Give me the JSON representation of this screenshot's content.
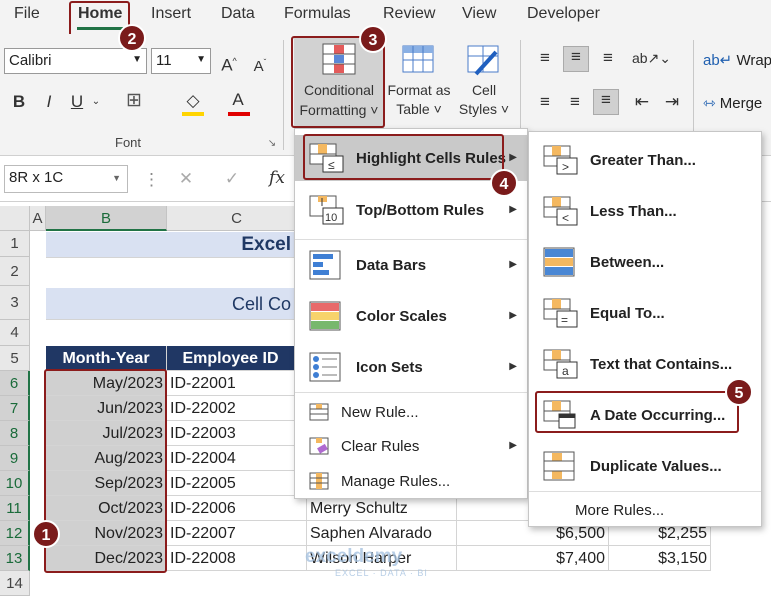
{
  "tabs": [
    "File",
    "Home",
    "Insert",
    "Data",
    "Formulas",
    "Review",
    "View",
    "Developer"
  ],
  "ribbon": {
    "font_name": "Calibri",
    "font_size": "11",
    "font_group_label": "Font",
    "conditional_formatting": [
      "Conditional",
      "Formatting ˅"
    ],
    "format_as_table": [
      "Format as",
      "Table ˅"
    ],
    "cell_styles": [
      "Cell",
      "Styles ˅"
    ],
    "wrap_text": "Wrap T",
    "merge": "Merge"
  },
  "formula_bar": {
    "name_box": "8R x 1C",
    "fx": "fx"
  },
  "columns": [
    "A",
    "B",
    "C"
  ],
  "rows": [
    "1",
    "2",
    "3",
    "4",
    "5",
    "6",
    "7",
    "8",
    "9",
    "10",
    "11",
    "12",
    "13",
    "14"
  ],
  "sheet": {
    "title_partial": "Excel",
    "subtitle_partial": "Cell Co",
    "header_b": "Month-Year",
    "header_c": "Employee ID",
    "data": [
      {
        "month": "May/2023",
        "id": "ID-22001"
      },
      {
        "month": "Jun/2023",
        "id": "ID-22002"
      },
      {
        "month": "Jul/2023",
        "id": "ID-22003"
      },
      {
        "month": "Aug/2023",
        "id": "ID-22004"
      },
      {
        "month": "Sep/2023",
        "id": "ID-22005"
      },
      {
        "month": "Oct/2023",
        "id": "ID-22006",
        "name": "Merry Schultz"
      },
      {
        "month": "Nov/2023",
        "id": "ID-22007",
        "name": "Saphen Alvarado",
        "v1": "$6,500",
        "v2": "$2,255"
      },
      {
        "month": "Dec/2023",
        "id": "ID-22008",
        "name": "Wilson Harper",
        "v1": "$7,400",
        "v2": "$3,150"
      }
    ]
  },
  "cf_menu": {
    "items": [
      "Highlight Cells Rules",
      "Top/Bottom Rules",
      "Data Bars",
      "Color Scales",
      "Icon Sets"
    ],
    "small_items": [
      "New Rule...",
      "Clear Rules",
      "Manage Rules..."
    ]
  },
  "sub_menu": {
    "items": [
      "Greater Than...",
      "Less Than...",
      "Between...",
      "Equal To...",
      "Text that Contains...",
      "A Date Occurring...",
      "Duplicate Values..."
    ],
    "more": "More Rules..."
  },
  "badges": [
    "1",
    "2",
    "3",
    "4",
    "5"
  ],
  "watermark": "exceldemy",
  "watermark_sub": "EXCEL · DATA · BI",
  "colors": {
    "accent": "#217346",
    "badge": "#7a1b1b",
    "header_fill": "#203764",
    "title_fill": "#d9e1f2"
  }
}
